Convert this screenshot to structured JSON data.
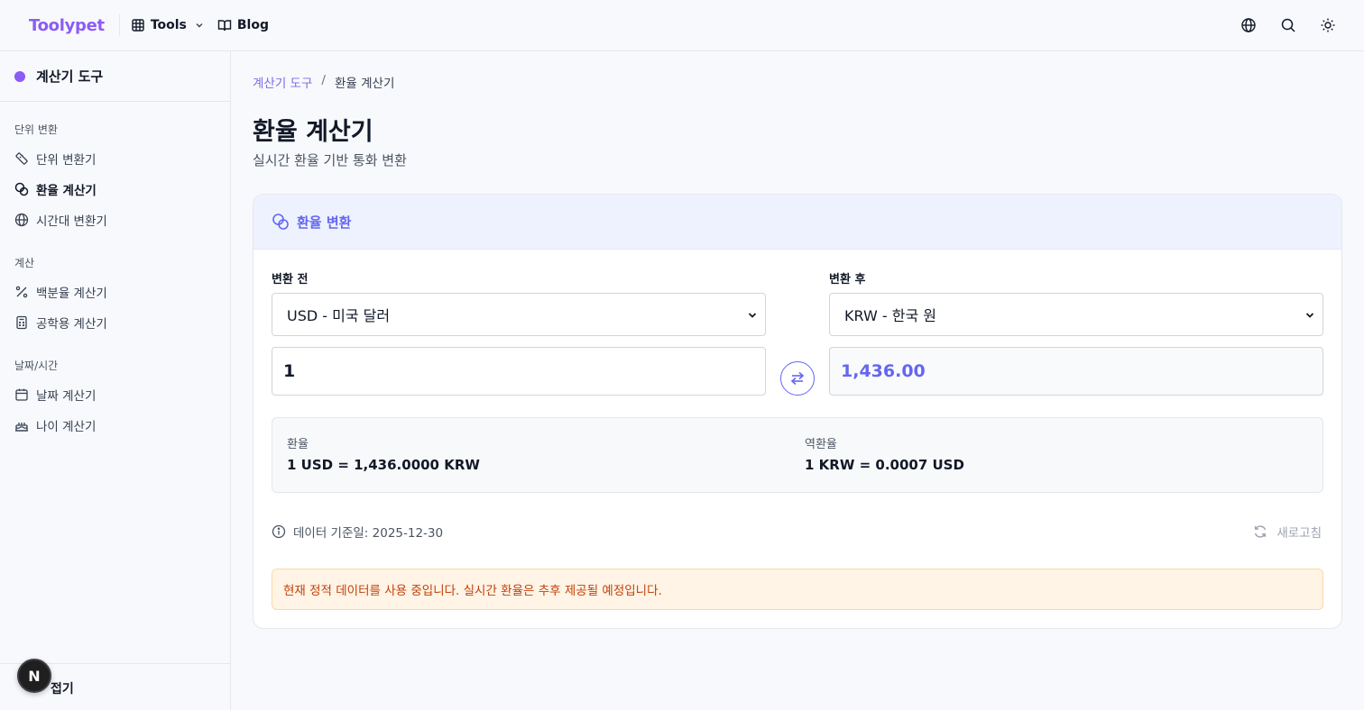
{
  "header": {
    "brand": "Toolypet",
    "nav": [
      {
        "label": "Tools",
        "icon": "grid-icon"
      },
      {
        "label": "Blog",
        "icon": "book-icon"
      }
    ],
    "icons": [
      "globe-icon",
      "search-icon",
      "sun-icon"
    ]
  },
  "sidebar": {
    "title": "계산기 도구",
    "accent": "#8b5cf6",
    "sections": [
      {
        "title": "단위 변환",
        "items": [
          {
            "label": "단위 변환기",
            "icon": "ruler-icon",
            "active": false
          },
          {
            "label": "환율 계산기",
            "icon": "coins-icon",
            "active": true
          },
          {
            "label": "시간대 변환기",
            "icon": "globe-icon",
            "active": false
          }
        ]
      },
      {
        "title": "계산",
        "items": [
          {
            "label": "백분율 계산기",
            "icon": "percent-icon",
            "active": false
          },
          {
            "label": "공학용 계산기",
            "icon": "calculator-icon",
            "active": false
          }
        ]
      },
      {
        "title": "날짜/시간",
        "items": [
          {
            "label": "날짜 계산기",
            "icon": "calendar-icon",
            "active": false
          },
          {
            "label": "나이 계산기",
            "icon": "cake-icon",
            "active": false
          }
        ]
      }
    ],
    "footer_label": "접기",
    "badge": "N"
  },
  "main": {
    "breadcrumb": {
      "parent": "계산기 도구",
      "separator": "/",
      "current": "환율 계산기"
    },
    "title": "환율 계산기",
    "subtitle": "실시간 환율 기반 통화 변환",
    "card": {
      "title": "환율 변환",
      "from": {
        "label": "변환 전",
        "currency": "USD - 미국 달러",
        "amount": "1"
      },
      "to": {
        "label": "변환 후",
        "currency": "KRW - 한국 원",
        "amount": "1,436.00"
      },
      "rate": {
        "label": "환율",
        "value": "1 USD = 1,436.0000 KRW"
      },
      "inverse_rate": {
        "label": "역환율",
        "value": "1 KRW = 0.0007 USD"
      },
      "data_date": "데이터 기준일: 2025-12-30",
      "refresh_label": "새로고침",
      "notice": "현재 정적 데이터를 사용 중입니다. 실시간 환율은 추후 제공될 예정입니다."
    },
    "accent": "#6366f1"
  }
}
